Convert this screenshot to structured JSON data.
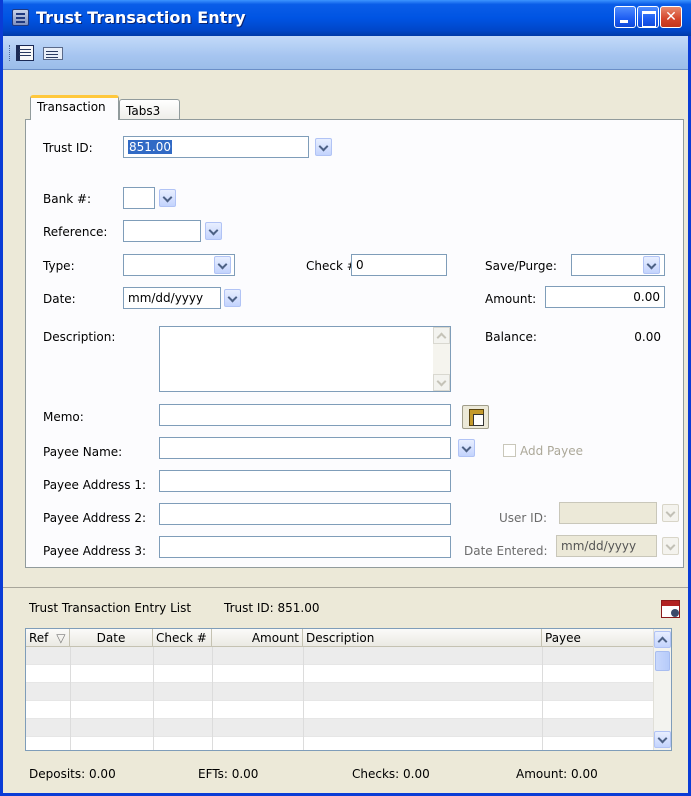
{
  "window": {
    "title": "Trust Transaction Entry"
  },
  "toolbar": {
    "buttons": [
      {
        "icon": "detail-view-icon"
      },
      {
        "icon": "list-view-icon"
      }
    ]
  },
  "tabs": [
    {
      "label": "Transaction",
      "active": true
    },
    {
      "label": "Tabs3",
      "active": false
    }
  ],
  "form": {
    "trust_id": {
      "label": "Trust ID:",
      "value": "851.00"
    },
    "bank": {
      "label": "Bank #:",
      "value": ""
    },
    "reference": {
      "label": "Reference:",
      "value": ""
    },
    "type": {
      "label": "Type:",
      "value": ""
    },
    "check": {
      "label": "Check #:",
      "value": "0"
    },
    "save_purge": {
      "label": "Save/Purge:",
      "value": ""
    },
    "date": {
      "label": "Date:",
      "value": "mm/dd/yyyy"
    },
    "amount": {
      "label": "Amount:",
      "value": "0.00"
    },
    "description": {
      "label": "Description:",
      "value": ""
    },
    "balance": {
      "label": "Balance:",
      "value": "0.00"
    },
    "memo": {
      "label": "Memo:",
      "value": ""
    },
    "payee_name": {
      "label": "Payee Name:",
      "value": ""
    },
    "add_payee": {
      "label": "Add Payee",
      "checked": false
    },
    "payee_address_1": {
      "label": "Payee Address 1:",
      "value": ""
    },
    "payee_address_2": {
      "label": "Payee Address 2:",
      "value": ""
    },
    "payee_address_3": {
      "label": "Payee Address 3:",
      "value": ""
    },
    "user_id": {
      "label": "User ID:",
      "value": ""
    },
    "date_entered": {
      "label": "Date Entered:",
      "value": "mm/dd/yyyy"
    }
  },
  "list": {
    "title": "Trust Transaction Entry List",
    "trust_id_text": "Trust ID: 851.00",
    "columns": [
      "Ref",
      "Date",
      "Check #",
      "Amount",
      "Description",
      "Payee"
    ],
    "sort_indicator": "▽"
  },
  "footer": {
    "deposits": "Deposits: 0.00",
    "efts": "EFTs: 0.00",
    "checks": "Checks: 0.00",
    "amount": "Amount: 0.00"
  },
  "colors": {
    "titlebar": "#0054e3",
    "selection": "#316ac5",
    "tab_accent": "#ffc83c"
  }
}
